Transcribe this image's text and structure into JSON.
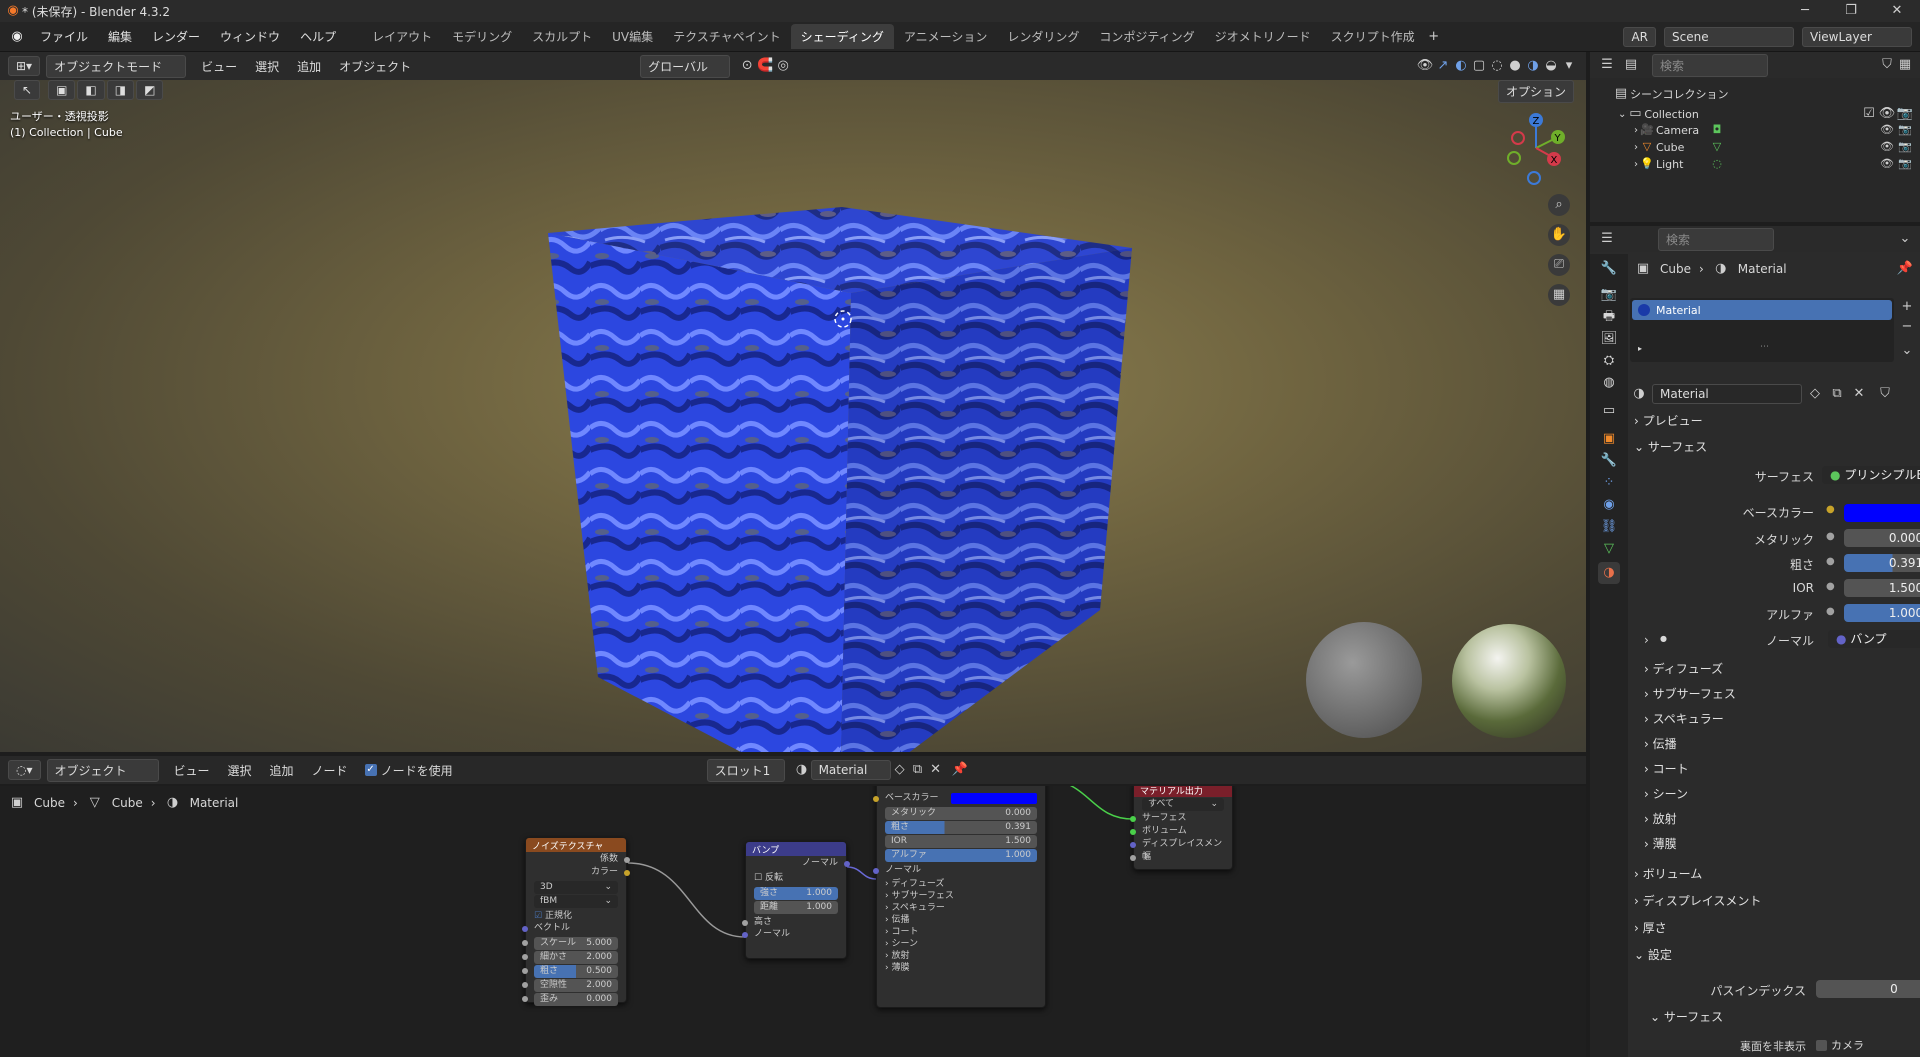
{
  "window": {
    "title": "* (未保存) - Blender 4.3.2"
  },
  "menu": [
    "ファイル",
    "編集",
    "レンダー",
    "ウィンドウ",
    "ヘルプ"
  ],
  "workspaces": [
    "レイアウト",
    "モデリング",
    "スカルプト",
    "UV編集",
    "テクスチャペイント",
    "シェーディング",
    "アニメーション",
    "レンダリング",
    "コンポジティング",
    "ジオメトリノード",
    "スクリプト作成"
  ],
  "active_workspace": "シェーディング",
  "topright": {
    "ar": "AR",
    "scene": "Scene",
    "viewlayer": "ViewLayer"
  },
  "viewport_header": {
    "mode": "オブジェクトモード",
    "menus": [
      "ビュー",
      "選択",
      "追加",
      "オブジェクト"
    ],
    "orientation": "グローバル",
    "options": "オプション"
  },
  "viewport": {
    "view_label": "ユーザー・透視投影",
    "collection_label": "(1) Collection | Cube"
  },
  "gizmo_axes": {
    "z": "Z",
    "y": "Y",
    "x": "X"
  },
  "node_header": {
    "mode": "オブジェクト",
    "menus": [
      "ビュー",
      "選択",
      "追加",
      "ノード"
    ],
    "use_nodes": "ノードを使用",
    "slot": "スロット1",
    "material": "Material"
  },
  "node_breadcrumb": [
    "Cube",
    "Cube",
    "Material"
  ],
  "nodes": {
    "noise": {
      "title": "ノイズテクスチャ",
      "out_fac": "係数",
      "out_color": "カラー",
      "dim": "3D",
      "type": "fBM",
      "normalize": "正規化",
      "vector": "ベクトル",
      "fields": [
        {
          "label": "スケール",
          "value": "5.000"
        },
        {
          "label": "細かさ",
          "value": "2.000"
        },
        {
          "label": "粗さ",
          "value": "0.500"
        },
        {
          "label": "空隙性",
          "value": "2.000"
        },
        {
          "label": "歪み",
          "value": "0.000"
        }
      ]
    },
    "bump": {
      "title": "バンプ",
      "out_normal": "ノーマル",
      "invert": "反転",
      "strength_label": "強さ",
      "strength": "1.000",
      "distance_label": "距離",
      "distance": "1.000",
      "height": "高さ",
      "normal": "ノーマル"
    },
    "bsdf": {
      "base_color": "ベースカラー",
      "metallic_label": "メタリック",
      "metallic": "0.000",
      "roughness_label": "粗さ",
      "roughness": "0.391",
      "ior_label": "IOR",
      "ior": "1.500",
      "alpha_label": "アルファ",
      "alpha": "1.000",
      "normal": "ノーマル",
      "panels": [
        "ディフューズ",
        "サブサーフェス",
        "スペキュラー",
        "伝播",
        "コート",
        "シーン",
        "放射",
        "薄膜"
      ]
    },
    "output": {
      "title": "マテリアル出力",
      "target": "すべて",
      "sockets": [
        "サーフェス",
        "ボリューム",
        "ディスプレイスメント",
        "幅"
      ]
    }
  },
  "outliner": {
    "search": "検索",
    "scene_collection": "シーンコレクション",
    "collection": "Collection",
    "items": [
      "Camera",
      "Cube",
      "Light"
    ]
  },
  "properties": {
    "search": "検索",
    "breadcrumb": [
      "Cube",
      "Material"
    ],
    "slot": "Material",
    "material_name": "Material",
    "preview": "プレビュー",
    "surface_panel": "サーフェス",
    "surface_label": "サーフェス",
    "surface_value": "プリンシプルBSDF",
    "base_color_label": "ベースカラー",
    "base_color": "#0000ff",
    "rows": [
      {
        "label": "メタリック",
        "value": "0.000",
        "fill": 0
      },
      {
        "label": "粗さ",
        "value": "0.391",
        "fill": 0.391
      },
      {
        "label": "IOR",
        "value": "1.500",
        "fill": 0
      },
      {
        "label": "アルファ",
        "value": "1.000",
        "fill": 1
      }
    ],
    "normal_label": "ノーマル",
    "normal_value": "バンプ",
    "subpanels": [
      "ディフューズ",
      "サブサーフェス",
      "スペキュラー",
      "伝播",
      "コート",
      "シーン",
      "放射",
      "薄膜"
    ],
    "volume": "ボリューム",
    "displacement": "ディスプレイスメント",
    "thickness": "厚さ",
    "settings": "設定",
    "pass_index_label": "パスインデックス",
    "pass_index": "0",
    "settings_surface": "サーフェス",
    "backface_label": "裏面を非表示",
    "backface_camera": "カメラ"
  },
  "colors": {
    "accent": "#4772b3",
    "noise_header": "#8a4a1f",
    "bump_header": "#3c3c8a",
    "output_header": "#7a1f2a"
  }
}
